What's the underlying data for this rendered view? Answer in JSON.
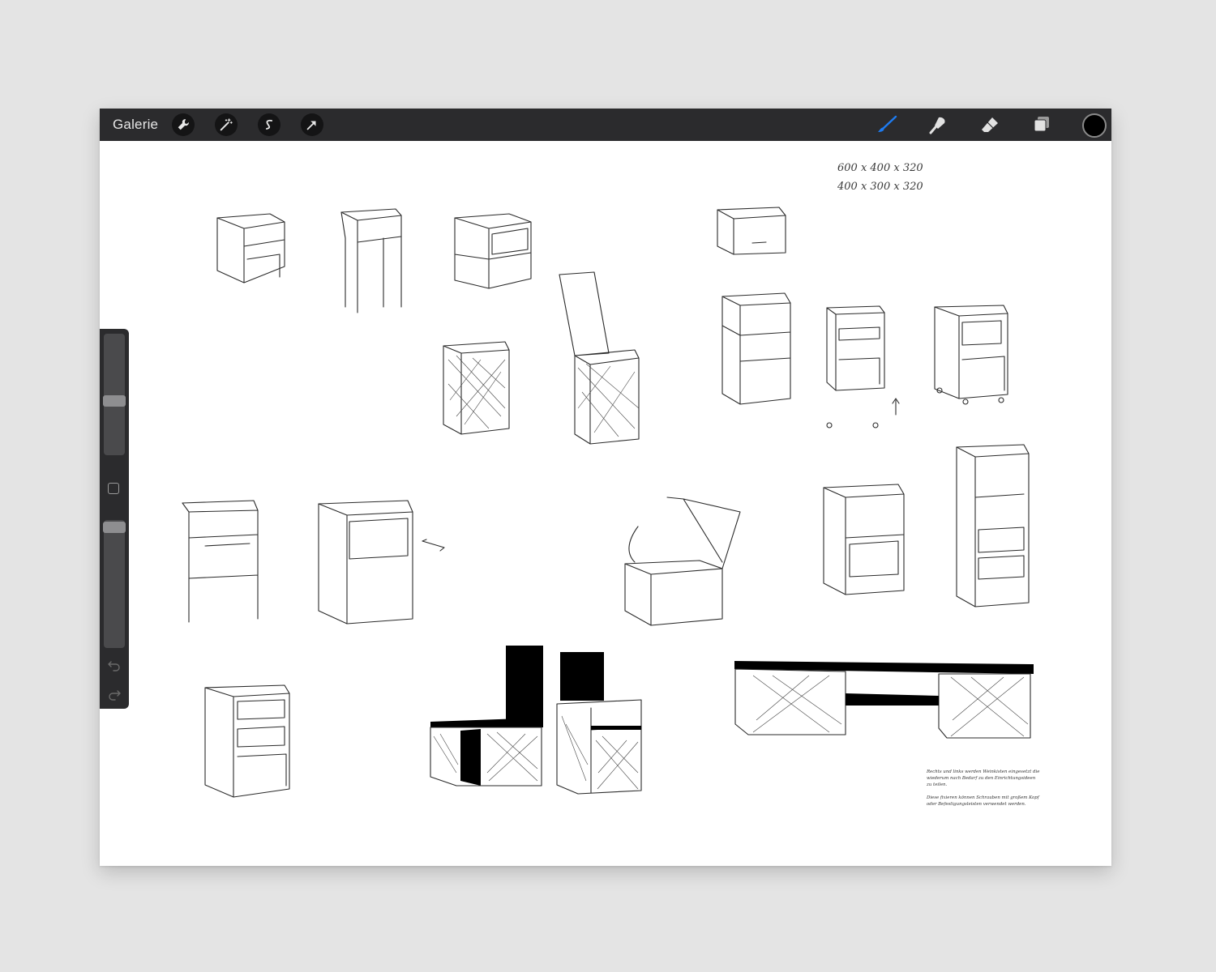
{
  "toolbar": {
    "gallery_label": "Galerie",
    "left_tools": [
      "wrench-icon",
      "magic-wand-icon",
      "selection-icon",
      "transform-arrow-icon"
    ],
    "right_tools": [
      "brush-icon",
      "smudge-icon",
      "eraser-icon",
      "layers-icon"
    ],
    "active_tool": "brush-icon",
    "active_color": "#1e7bf0",
    "current_color": "#000000"
  },
  "sidebar": {
    "size_slider_level": 0.53,
    "opacity_slider_level": 0.98
  },
  "canvas": {
    "dimension_lines": [
      "600 x 400 x 320",
      "400 x 300 x 320"
    ],
    "note_paragraphs": [
      "Rechts und links werden Weinkisten eingesetzt die wiederum nach Bedarf zu den Einrichtungsideen zu teilen.",
      "Diese fixieren können Schrauben mit großem Kopf oder Befestigungsleisten verwendet werden."
    ]
  }
}
